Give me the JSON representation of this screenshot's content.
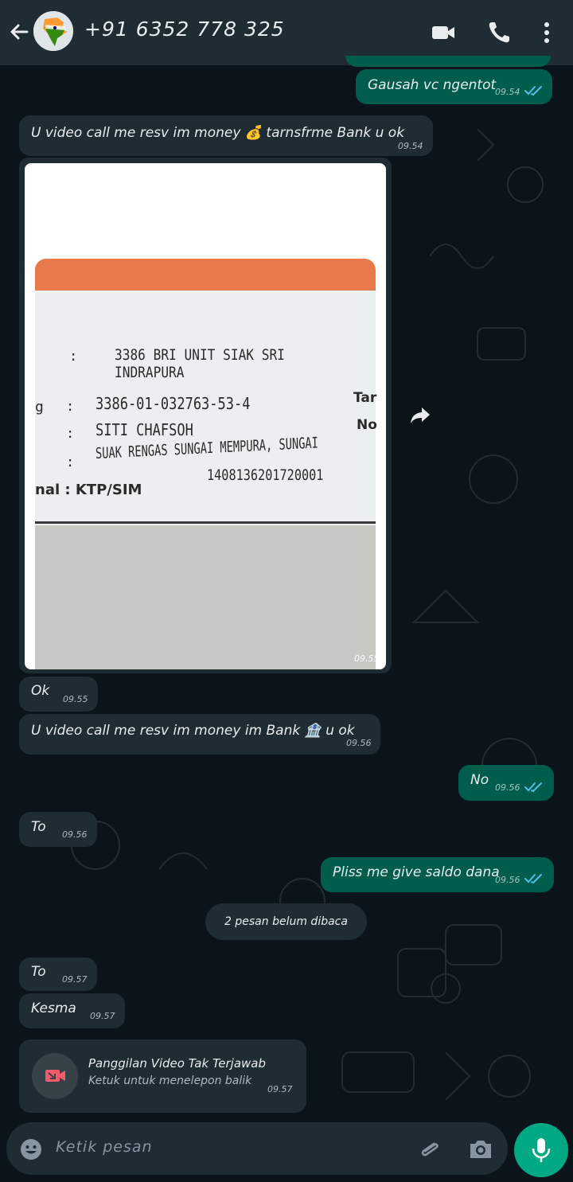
{
  "header": {
    "contact": "+91 6352 778 325",
    "icons": [
      "back-arrow-icon",
      "avatar",
      "video-call-icon",
      "voice-call-icon",
      "more-options-icon"
    ]
  },
  "messages": [
    {
      "dir": "out",
      "text": "Gausah vc ngentot",
      "time": "09.54",
      "status": "read"
    },
    {
      "dir": "in",
      "text": "U video call me resv im money 💰 tarnsfrme Bank u ok",
      "time": "09.54"
    },
    {
      "dir": "in",
      "type": "image",
      "time": "09.55",
      "image": {
        "line1": "3386 BRI UNIT SIAK SRI INDRAPURA",
        "line2": "3386-01-032763-53-4",
        "line3": "SITI CHAFSOH",
        "line4": "SUAK RENGAS SUNGAI MEMPURA, SUNGAI",
        "line5": "1408136201720001",
        "label_left1": "g",
        "label_right1": "Tar",
        "label_right2": "No",
        "label_ktp": "nal : KTP/SIM",
        "colon": ":"
      }
    },
    {
      "dir": "in",
      "text": "Ok",
      "time": "09.55"
    },
    {
      "dir": "in",
      "text": "U video call me resv im money im Bank 🏦 u ok",
      "time": "09.56"
    },
    {
      "dir": "out",
      "text": "No",
      "time": "09.56",
      "status": "read"
    },
    {
      "dir": "in",
      "text": "To",
      "time": "09.56"
    },
    {
      "dir": "out",
      "text": "Pliss me give saldo dana",
      "time": "09.56",
      "status": "read"
    },
    {
      "dir": "in",
      "text": "To",
      "time": "09.57"
    },
    {
      "dir": "in",
      "text": "Kesma",
      "time": "09.57"
    }
  ],
  "unread_banner": "2 pesan belum dibaca",
  "missed_call": {
    "title": "Panggilan Video Tak Terjawab",
    "subtitle": "Ketuk untuk menelepon balik",
    "time": "09.57"
  },
  "input": {
    "placeholder": "Ketik pesan"
  },
  "colors": {
    "background": "#0b141a",
    "header": "#1f2c34",
    "incoming": "#202c33",
    "outgoing": "#005c4b",
    "accent": "#00a884",
    "read_ticks": "#53bdeb",
    "missed_call_red": "#f15c6d"
  }
}
